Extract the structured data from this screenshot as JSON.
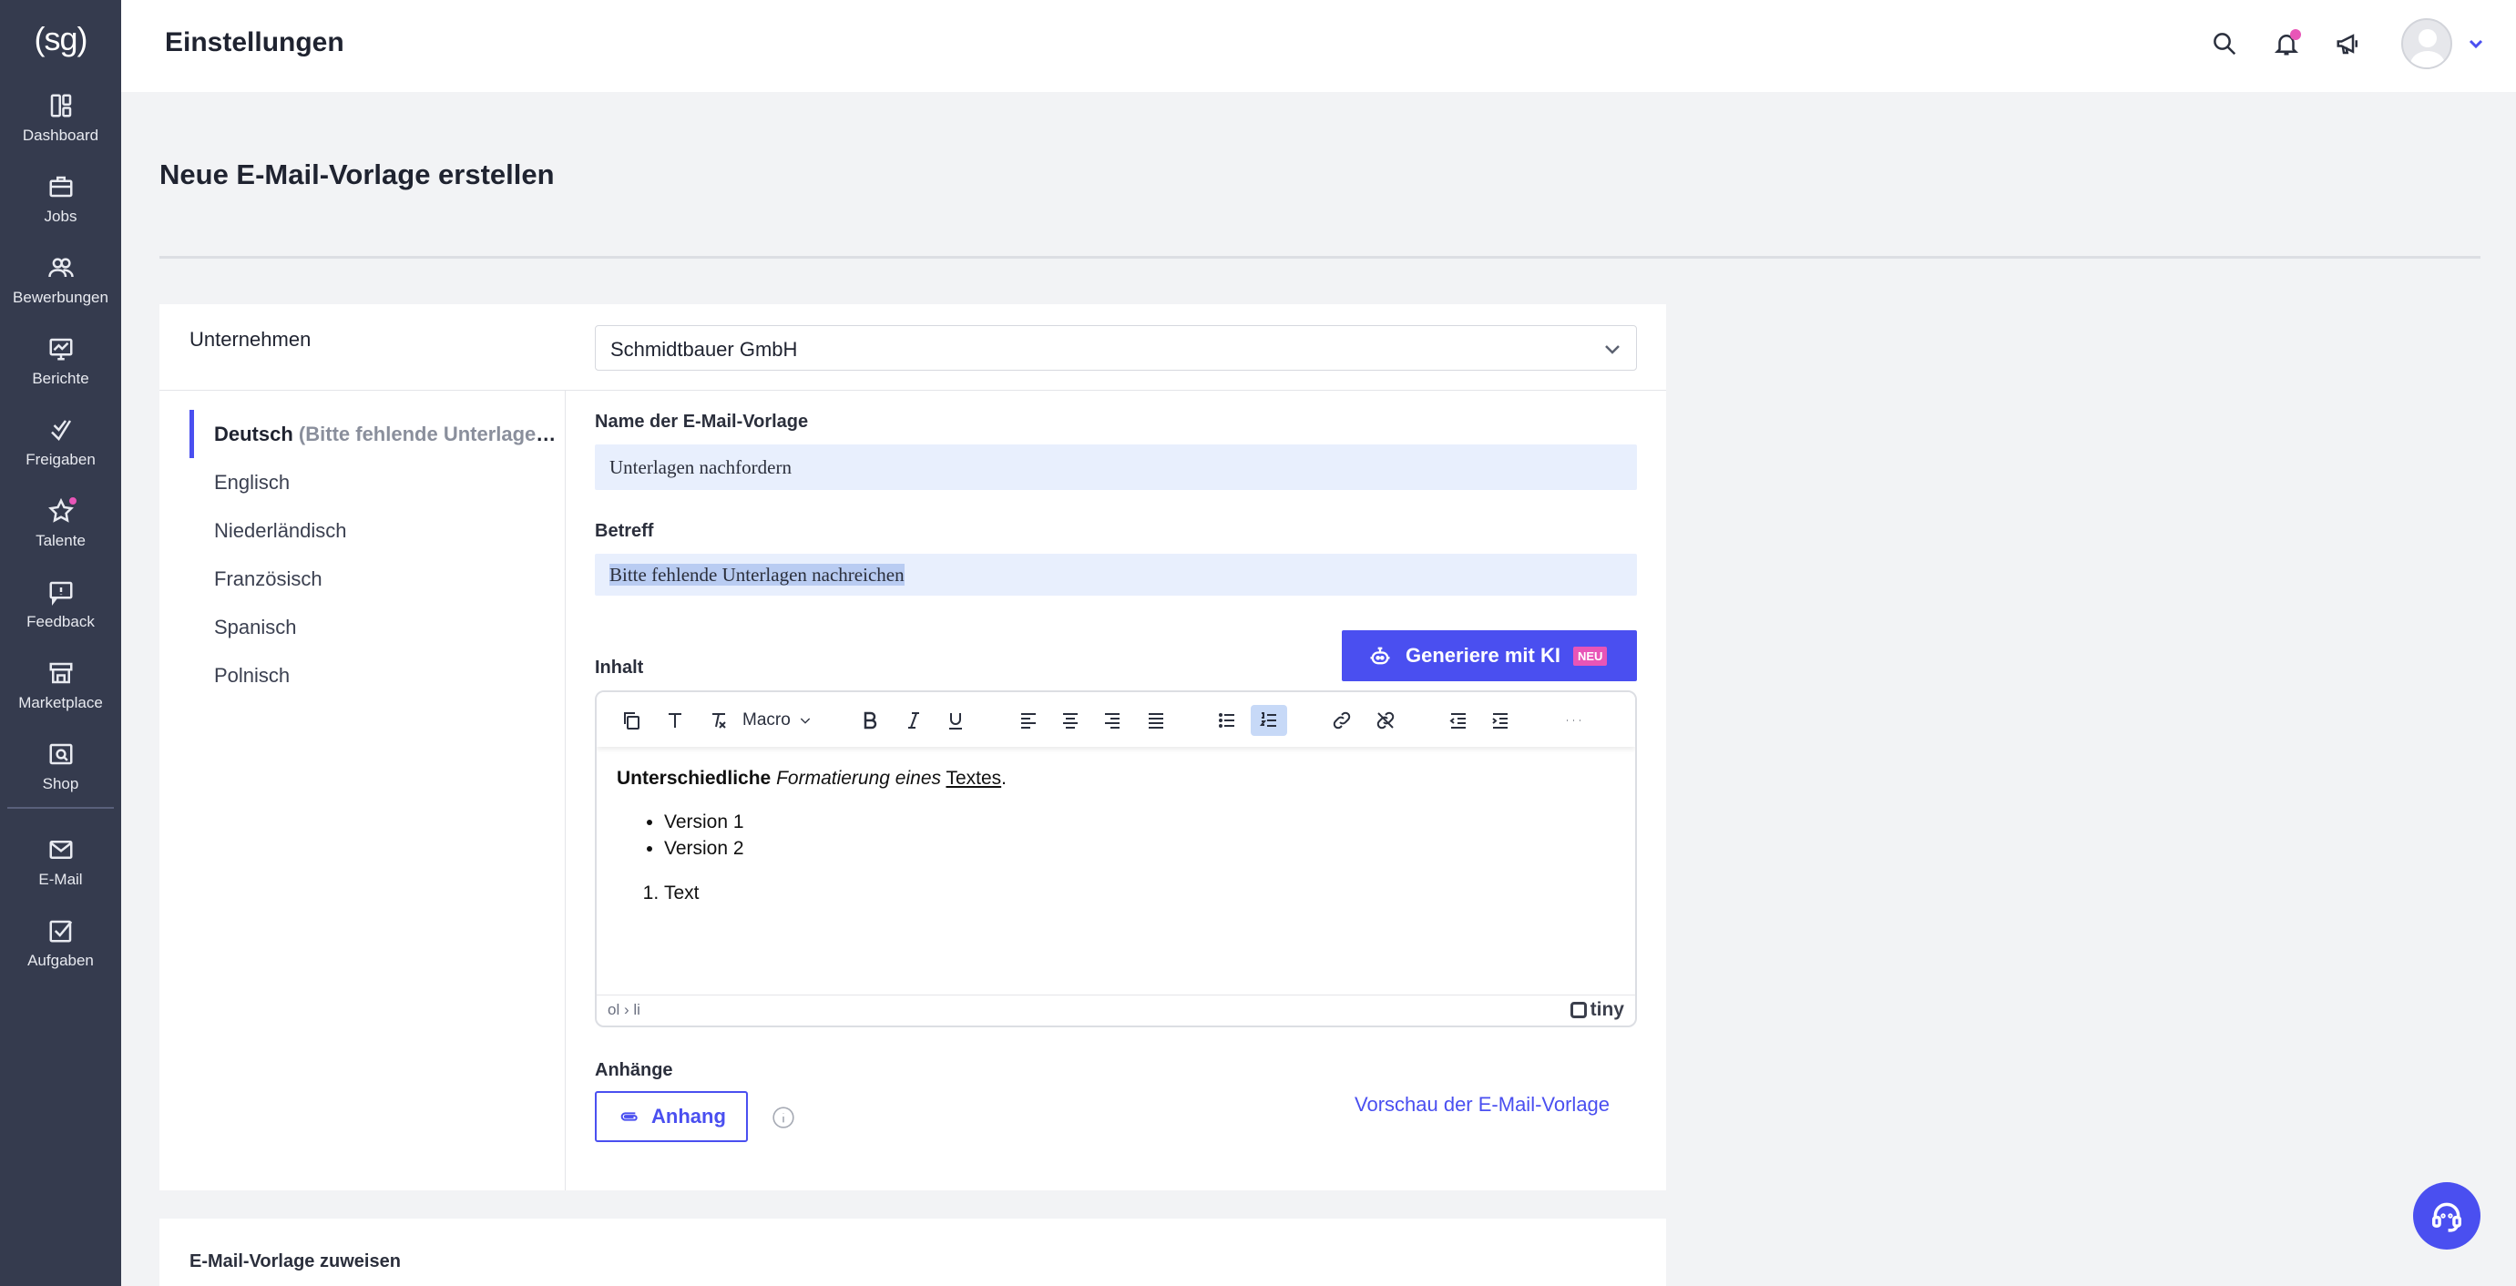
{
  "brand": {
    "logo_text": "(sg)"
  },
  "sidebar": {
    "items": [
      {
        "label": "Dashboard",
        "icon": "dashboard-icon"
      },
      {
        "label": "Jobs",
        "icon": "briefcase-icon"
      },
      {
        "label": "Bewerbungen",
        "icon": "users-icon"
      },
      {
        "label": "Berichte",
        "icon": "report-icon"
      },
      {
        "label": "Freigaben",
        "icon": "approval-icon"
      },
      {
        "label": "Talente",
        "icon": "star-icon",
        "badge": true
      },
      {
        "label": "Feedback",
        "icon": "feedback-icon"
      },
      {
        "label": "Marketplace",
        "icon": "store-icon"
      },
      {
        "label": "Shop",
        "icon": "shop-icon"
      },
      {
        "label": "E-Mail",
        "icon": "mail-icon"
      },
      {
        "label": "Aufgaben",
        "icon": "tasks-icon"
      }
    ]
  },
  "header": {
    "title": "Einstellungen"
  },
  "page": {
    "heading": "Neue E-Mail-Vorlage erstellen"
  },
  "form": {
    "company_label": "Unternehmen",
    "company_value": "Schmidtbauer GmbH",
    "languages": [
      {
        "label": "Deutsch",
        "hint": "(Bitte fehlende Unterlagen nachreichen)",
        "active": true
      },
      {
        "label": "Englisch"
      },
      {
        "label": "Niederländisch"
      },
      {
        "label": "Französisch"
      },
      {
        "label": "Spanisch"
      },
      {
        "label": "Polnisch"
      }
    ],
    "name_label": "Name der E-Mail-Vorlage",
    "name_value": "Unterlagen nachfordern",
    "subject_label": "Betreff",
    "subject_value": "Bitte fehlende Unterlagen nachreichen",
    "content_label": "Inhalt",
    "ai_button": "Generiere mit KI",
    "ai_badge": "NEU",
    "editor": {
      "macro_label": "Macro",
      "content": {
        "bold": "Unterschiedliche",
        "italic": "Formatierung eines",
        "underline": "Textes",
        "period": ".",
        "bullets": [
          "Version 1",
          "Version 2"
        ],
        "numbered": [
          "Text"
        ]
      },
      "statusbar_path": "ol › li",
      "brand": "tiny"
    },
    "attachments_label": "Anhänge",
    "attach_button": "Anhang",
    "preview_link": "Vorschau der E-Mail-Vorlage"
  },
  "assign_section": {
    "title": "E-Mail-Vorlage zuweisen"
  },
  "colors": {
    "accent": "#4a4ff0",
    "sidebar": "#353b4e",
    "badge": "#e855b7"
  }
}
